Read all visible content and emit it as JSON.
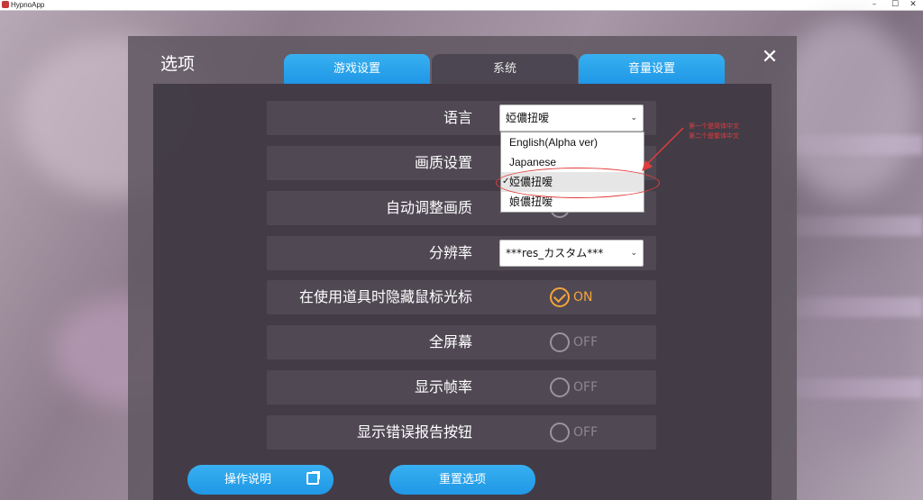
{
  "window": {
    "title": "HypnoApp",
    "min": "–",
    "max": "☐",
    "close": "✕"
  },
  "dialog": {
    "title": "选项",
    "close": "✕",
    "tabs": [
      {
        "label": "游戏设置"
      },
      {
        "label": "系统"
      },
      {
        "label": "音量设置"
      }
    ],
    "settings": {
      "language": {
        "label": "语言",
        "value": "婭儂扭嗳"
      },
      "quality": {
        "label": "画质设置"
      },
      "auto_quality": {
        "label": "自动调整画质"
      },
      "resolution": {
        "label": "分辨率",
        "value": "***res_カスタム***"
      },
      "hide_cursor": {
        "label": "在使用道具时隐藏鼠标光标",
        "state": "ON"
      },
      "fullscreen": {
        "label": "全屏幕",
        "state": "OFF"
      },
      "show_fps": {
        "label": "显示帧率",
        "state": "OFF"
      },
      "show_error_btn": {
        "label": "显示错误报告按钮",
        "state": "OFF"
      }
    },
    "dropdown": {
      "options": [
        "English(Alpha ver)",
        "Japanese",
        "婭儂扭嗳",
        "娘儂扭嗳"
      ],
      "check": "✓"
    },
    "buttons": {
      "manual": "操作说明",
      "reset": "重置选项"
    }
  },
  "annotation": {
    "line1": "第一个是简体中文",
    "line2": "第二个是繁体中文"
  },
  "colors": {
    "tab_blue": "#1f97e6",
    "toggle_on": "#f4a43a",
    "annotation": "#e23c3c"
  }
}
